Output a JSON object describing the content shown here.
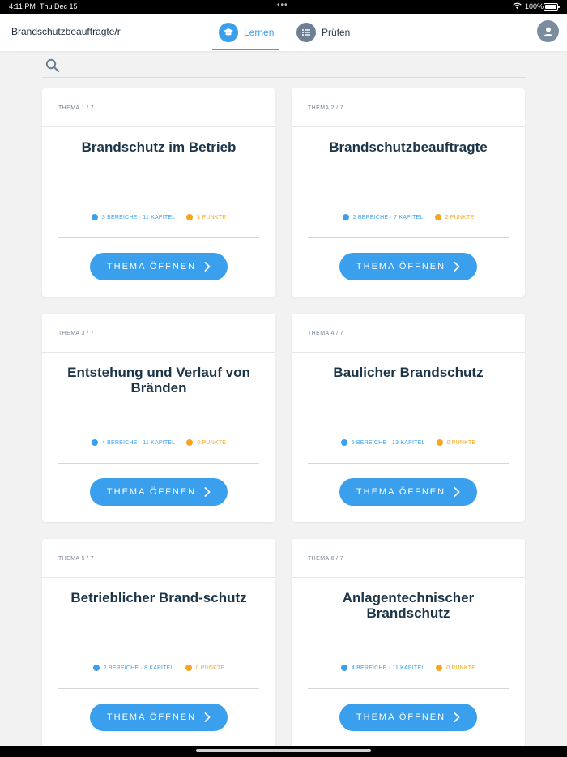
{
  "status_bar": {
    "time": "4:11 PM",
    "date": "Thu Dec 15",
    "battery": "100%"
  },
  "header": {
    "app_title": "Brandschutzbeauftragte/r",
    "tabs": [
      {
        "label": "Lernen",
        "active": true
      },
      {
        "label": "Prüfen",
        "active": false
      }
    ]
  },
  "colors": {
    "accent": "#3aa0ee",
    "points": "#f6a51d",
    "title": "#1b3447"
  },
  "cards": [
    {
      "counter": "THEMA 1 / 7",
      "title": "Brandschutz im Betrieb",
      "areas": "3 BEREICHE · 11 KAPITEL",
      "points": "1 PUNKTE",
      "button": "THEMA ÖFFNEN"
    },
    {
      "counter": "THEMA 2 / 7",
      "title": "Brandschutzbeauftragte",
      "areas": "2 BEREICHE · 7 KAPITEL",
      "points": "2 PUNKTE",
      "button": "THEMA ÖFFNEN"
    },
    {
      "counter": "THEMA 3 / 7",
      "title": "Entstehung und Verlauf von Bränden",
      "areas": "4 BEREICHE · 11 KAPITEL",
      "points": "0 PUNKTE",
      "button": "THEMA ÖFFNEN"
    },
    {
      "counter": "THEMA 4 / 7",
      "title": "Baulicher Brandschutz",
      "areas": "5 BEREICHE · 13 KAPITEL",
      "points": "0 PUNKTE",
      "button": "THEMA ÖFFNEN"
    },
    {
      "counter": "THEMA 5 / 7",
      "title": "Betrieblicher Brand-schutz",
      "areas": "2 BEREICHE · 8 KAPITEL",
      "points": "0 PUNKTE",
      "button": "THEMA ÖFFNEN"
    },
    {
      "counter": "THEMA 6 / 7",
      "title": "Anlagentechnischer Brandschutz",
      "areas": "4 BEREICHE · 11 KAPITEL",
      "points": "0 PUNKTE",
      "button": "THEMA ÖFFNEN"
    }
  ]
}
